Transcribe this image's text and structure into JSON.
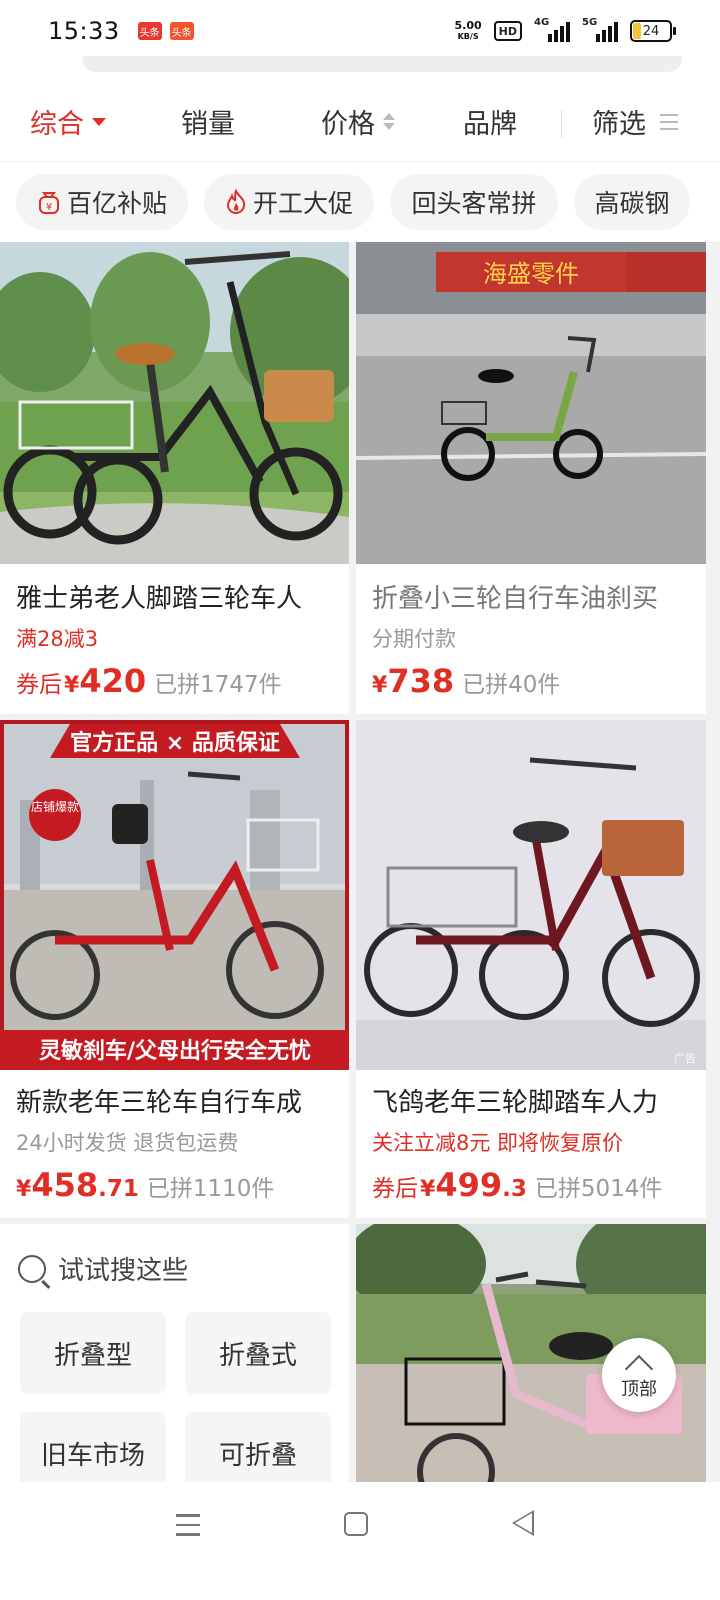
{
  "status_bar": {
    "time": "15:33",
    "app_icons": [
      "头条",
      "头条"
    ],
    "net_speed_value": "5.00",
    "net_speed_unit": "KB/S",
    "hd_label": "HD",
    "signal_1_label": "4G",
    "signal_2_label": "5G",
    "battery": "24"
  },
  "sort_bar": {
    "items": [
      "综合",
      "销量",
      "价格",
      "品牌",
      "筛选"
    ]
  },
  "chips": [
    {
      "label": "百亿补贴",
      "icon": "money-bag-icon"
    },
    {
      "label": "开工大促",
      "icon": "flame-icon"
    },
    {
      "label": "回头客常拼"
    },
    {
      "label": "高碳钢"
    }
  ],
  "products": [
    {
      "title": "雅士弟老人脚踏三轮车人",
      "tag": "满28减3",
      "price_prefix": "券后",
      "currency": "¥",
      "price_int": "420",
      "price_dec": "",
      "sold": "已拼1747件"
    },
    {
      "title": "折叠小三轮自行车油刹买",
      "tag": "分期付款",
      "price_prefix": "",
      "currency": "¥",
      "price_int": "738",
      "price_dec": "",
      "sold": "已拼40件",
      "image_text": "海盛零件"
    },
    {
      "title": "新款老年三轮车自行车成",
      "tag": "24小时发货  退货包运费",
      "price_prefix": "",
      "currency": "¥",
      "price_int": "458",
      "price_dec": ".71",
      "sold": "已拼1110件",
      "banner_top": "官方正品 × 品质保证",
      "banner_bottom": "灵敏刹车/父母出行安全无忧",
      "badge": "店铺爆款"
    },
    {
      "title": "飞鸽老年三轮脚踏车人力",
      "tag": "关注立减8元  即将恢复原价",
      "price_prefix": "券后",
      "currency": "¥",
      "price_int": "499",
      "price_dec": ".3",
      "sold": "已拼5014件",
      "ad_label": "广告"
    }
  ],
  "try_search": {
    "heading": "试试搜这些",
    "items": [
      "折叠型",
      "折叠式",
      "旧车市场",
      "可折叠"
    ]
  },
  "top_button": {
    "label": "顶部"
  },
  "colors": {
    "accent": "#e02e24",
    "background": "#f2f2f2"
  }
}
